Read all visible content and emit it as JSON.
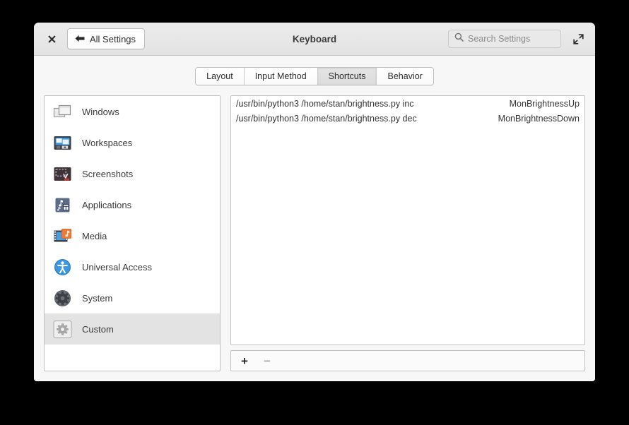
{
  "window": {
    "title": "Keyboard",
    "close_icon": "close-icon",
    "expand_icon": "expand-icon",
    "back_button_label": "All Settings",
    "back_icon": "arrow-left-icon"
  },
  "search": {
    "placeholder": "Search Settings",
    "value": "",
    "icon": "search-icon"
  },
  "tabs": [
    {
      "label": "Layout",
      "active": false
    },
    {
      "label": "Input Method",
      "active": false
    },
    {
      "label": "Shortcuts",
      "active": true
    },
    {
      "label": "Behavior",
      "active": false
    }
  ],
  "sidebar": {
    "items": [
      {
        "label": "Windows",
        "icon": "windows-icon",
        "selected": false
      },
      {
        "label": "Workspaces",
        "icon": "workspaces-icon",
        "selected": false
      },
      {
        "label": "Screenshots",
        "icon": "screenshots-icon",
        "selected": false
      },
      {
        "label": "Applications",
        "icon": "applications-icon",
        "selected": false
      },
      {
        "label": "Media",
        "icon": "media-icon",
        "selected": false
      },
      {
        "label": "Universal Access",
        "icon": "universal-access-icon",
        "selected": false
      },
      {
        "label": "System",
        "icon": "system-icon",
        "selected": false
      },
      {
        "label": "Custom",
        "icon": "custom-gear-icon",
        "selected": true
      }
    ]
  },
  "shortcuts": {
    "rows": [
      {
        "command": "/usr/bin/python3 /home/stan/brightness.py inc",
        "binding": "MonBrightnessUp"
      },
      {
        "command": "/usr/bin/python3 /home/stan/brightness.py dec",
        "binding": "MonBrightnessDown"
      }
    ],
    "add_label": "+",
    "remove_label": "−"
  },
  "colors": {
    "selection": "#e3e3e3",
    "window_bg": "#f7f7f7",
    "accent_blue": "#3a97e0",
    "accent_orange": "#f07a34",
    "desktop": "#000000"
  }
}
